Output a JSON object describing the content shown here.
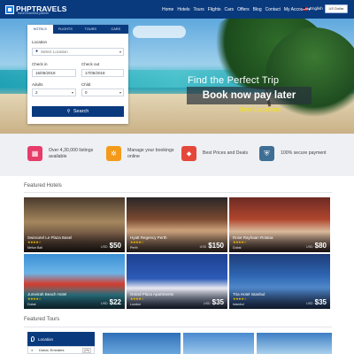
{
  "header": {
    "logo_text": "PHPTRAVELS",
    "logo_tagline": "travel business partner",
    "nav": [
      "Home",
      "Hotels",
      "Tours",
      "Flights",
      "Cars",
      "Offers",
      "Blog",
      "Contact",
      "My Account ▾"
    ],
    "language": "English",
    "currency": "US Dollar"
  },
  "hero": {
    "headline": "Find the Perfect Trip",
    "cta": "Book now pay later",
    "tagline": "Best Locations"
  },
  "search": {
    "tabs": [
      "HOTELS",
      "FLIGHTS",
      "TOURS",
      "CARS"
    ],
    "location_label": "Location",
    "location_placeholder": "Select Location",
    "checkin_label": "Check in",
    "checkin_value": "16/05/2018",
    "checkout_label": "Check out",
    "checkout_value": "17/05/2018",
    "adults_label": "Adults",
    "adults_value": "2",
    "child_label": "Child",
    "child_value": "0",
    "button": "Search"
  },
  "features": [
    {
      "icon": "building-icon",
      "text": "Over 4,30,000 listings available",
      "color": "#e63c6a"
    },
    {
      "icon": "gear-icon",
      "text": "Manage your bookings online",
      "color": "#f49a1a"
    },
    {
      "icon": "tag-icon",
      "text": "Best Prices and Deals",
      "color": "#e5473a"
    },
    {
      "icon": "shield-icon",
      "text": "100% secure payment",
      "color": "#3e6e94"
    }
  ],
  "featured_hotels": {
    "title": "Featured Hotels",
    "items": [
      {
        "name": "Swissotel Le Plaza Basel",
        "stars": "★★★★☆",
        "location": "Mekar Bali",
        "currency": "USD",
        "price": "$50"
      },
      {
        "name": "Hyatt Regency Perth",
        "stars": "★★★★☆",
        "location": "Perth",
        "currency": "USD",
        "price": "$150"
      },
      {
        "name": "Rose Rayhaan Rotana",
        "stars": "★★★★☆",
        "location": "Dubai",
        "currency": "USD",
        "price": "$80"
      },
      {
        "name": "Jumeirah Beach Hotel",
        "stars": "★★★★☆",
        "location": "Dubai",
        "currency": "USD",
        "price": "$22"
      },
      {
        "name": "Grand Plaza Apartments",
        "stars": "★★★★☆",
        "location": "London",
        "currency": "USD",
        "price": "$35"
      },
      {
        "name": "Tria Hotel Istanbul",
        "stars": "★★★★☆",
        "location": "Istanbul",
        "currency": "USD",
        "price": "$35"
      }
    ]
  },
  "featured_tours": {
    "title": "Featured Tours",
    "location_label": "Location",
    "first_location": "Dubai, Emirates",
    "first_count": "(29)"
  }
}
